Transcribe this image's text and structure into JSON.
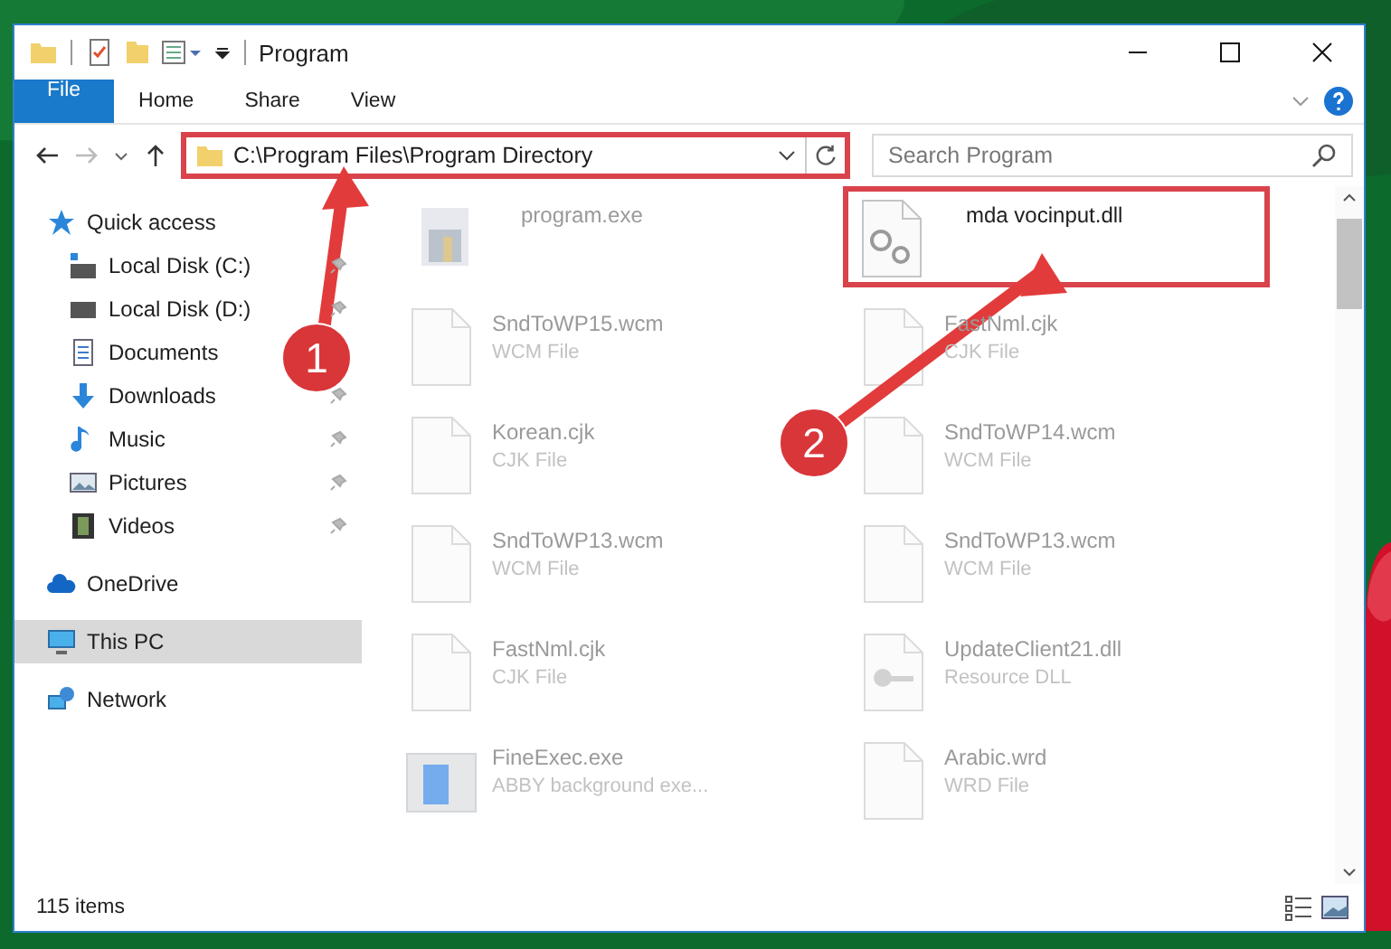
{
  "window": {
    "title": "Program"
  },
  "ribbon_tabs": [
    {
      "label": "File",
      "kind": "file"
    },
    {
      "label": "Home",
      "kind": "tab"
    },
    {
      "label": "Share",
      "kind": "tab"
    },
    {
      "label": "View",
      "kind": "tab"
    }
  ],
  "address": {
    "path": "C:\\Program Files\\Program Directory",
    "highlighted": true
  },
  "search": {
    "placeholder": "Search Program"
  },
  "sidebar": {
    "items": [
      {
        "label": "Quick access",
        "kind": "star",
        "selected": false,
        "children": [
          {
            "label": "Local Disk (C:)",
            "kind": "diskc",
            "pinned": true,
            "selected": false
          },
          {
            "label": "Local Disk (D:)",
            "kind": "disk",
            "pinned": true,
            "selected": false
          },
          {
            "label": "Documents",
            "kind": "docs",
            "pinned": false,
            "selected": false
          },
          {
            "label": "Downloads",
            "kind": "download",
            "pinned": true,
            "selected": false
          },
          {
            "label": "Music",
            "kind": "music",
            "pinned": true,
            "selected": false
          },
          {
            "label": "Pictures",
            "kind": "pictures",
            "pinned": true,
            "selected": false
          },
          {
            "label": "Videos",
            "kind": "videos",
            "pinned": true,
            "selected": false
          }
        ]
      },
      {
        "label": "OneDrive",
        "kind": "cloud",
        "selected": false
      },
      {
        "label": "This PC",
        "kind": "pc",
        "selected": true
      },
      {
        "label": "Network",
        "kind": "network",
        "selected": false
      }
    ]
  },
  "files": [
    {
      "name": "program.exe",
      "kind": "exe",
      "highlighted": false
    },
    {
      "name": "mda vocinput.dll",
      "kind": "gear",
      "highlighted": true
    },
    {
      "name": "SndToWP15.wcm",
      "type": "WCM File",
      "kind": "blank",
      "highlighted": false
    },
    {
      "name": "FastNml.cjk",
      "type": "CJK File",
      "kind": "blank",
      "highlighted": false
    },
    {
      "name": "Korean.cjk",
      "type": "CJK File",
      "kind": "blank",
      "highlighted": false
    },
    {
      "name": "SndToWP14.wcm",
      "type": "WCM File",
      "kind": "blank",
      "highlighted": false
    },
    {
      "name": "SndToWP13.wcm",
      "type": "WCM File",
      "kind": "blank",
      "highlighted": false
    },
    {
      "name": "SndToWP13.wcm",
      "type": "WCM File",
      "kind": "blank",
      "highlighted": false
    },
    {
      "name": "FastNml.cjk",
      "type": "CJK File",
      "kind": "blank",
      "highlighted": false
    },
    {
      "name": "UpdateClient21.dll",
      "type": "Resource DLL",
      "kind": "key",
      "highlighted": false
    },
    {
      "name": "FineExec.exe",
      "type": "ABBY background exe...",
      "kind": "app",
      "highlighted": false
    },
    {
      "name": "Arabic.wrd",
      "type": "WRD File",
      "kind": "blank",
      "highlighted": false
    }
  ],
  "status_bar": {
    "count": "115 items"
  },
  "annotations": [
    {
      "label": "1"
    },
    {
      "label": "2"
    }
  ]
}
